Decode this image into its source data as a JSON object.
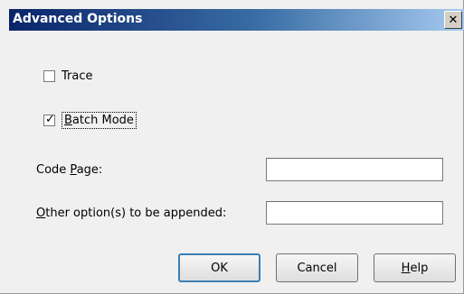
{
  "window": {
    "title": "Advanced Options",
    "close_glyph": "✕"
  },
  "options": {
    "trace": {
      "label": "Trace",
      "checked": false
    },
    "batch_mode": {
      "label_pre": "",
      "label_accel": "B",
      "label_post": "atch Mode",
      "checked": true
    }
  },
  "fields": {
    "code_page": {
      "label_pre": "Code ",
      "label_accel": "P",
      "label_post": "age:",
      "value": ""
    },
    "other_options": {
      "label_pre": "",
      "label_accel": "O",
      "label_post": "ther option(s) to be appended:",
      "value": ""
    }
  },
  "buttons": {
    "ok": "OK",
    "cancel": "Cancel",
    "help_accel": "H",
    "help_post": "elp"
  }
}
